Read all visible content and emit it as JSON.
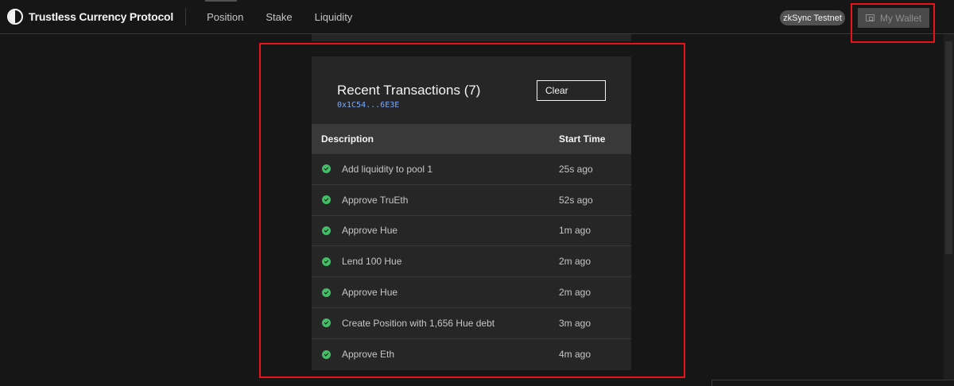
{
  "header": {
    "brand": "Trustless Currency Protocol",
    "nav": [
      {
        "label": "Position"
      },
      {
        "label": "Stake"
      },
      {
        "label": "Liquidity"
      }
    ],
    "network": "zkSync Testnet",
    "wallet_label": "My Wallet"
  },
  "modal": {
    "title": "Recent Transactions (7)",
    "address": "0x1C54...6E3E",
    "clear_label": "Clear",
    "columns": {
      "description": "Description",
      "start_time": "Start Time"
    },
    "rows": [
      {
        "description": "Add liquidity to pool 1",
        "time": "25s ago",
        "status": "success"
      },
      {
        "description": "Approve TruEth",
        "time": "52s ago",
        "status": "success"
      },
      {
        "description": "Approve Hue",
        "time": "1m ago",
        "status": "success"
      },
      {
        "description": "Lend 100 Hue",
        "time": "2m ago",
        "status": "success"
      },
      {
        "description": "Approve Hue",
        "time": "2m ago",
        "status": "success"
      },
      {
        "description": "Create Position with 1,656 Hue debt",
        "time": "3m ago",
        "status": "success"
      },
      {
        "description": "Approve Eth",
        "time": "4m ago",
        "status": "success"
      }
    ]
  },
  "colors": {
    "background": "#161616",
    "card": "#262626",
    "success": "#42be65",
    "address": "#78a9ff",
    "highlight": "#e8141c"
  },
  "icons": [
    "logo-icon",
    "wallet-icon",
    "check-circle-icon"
  ]
}
